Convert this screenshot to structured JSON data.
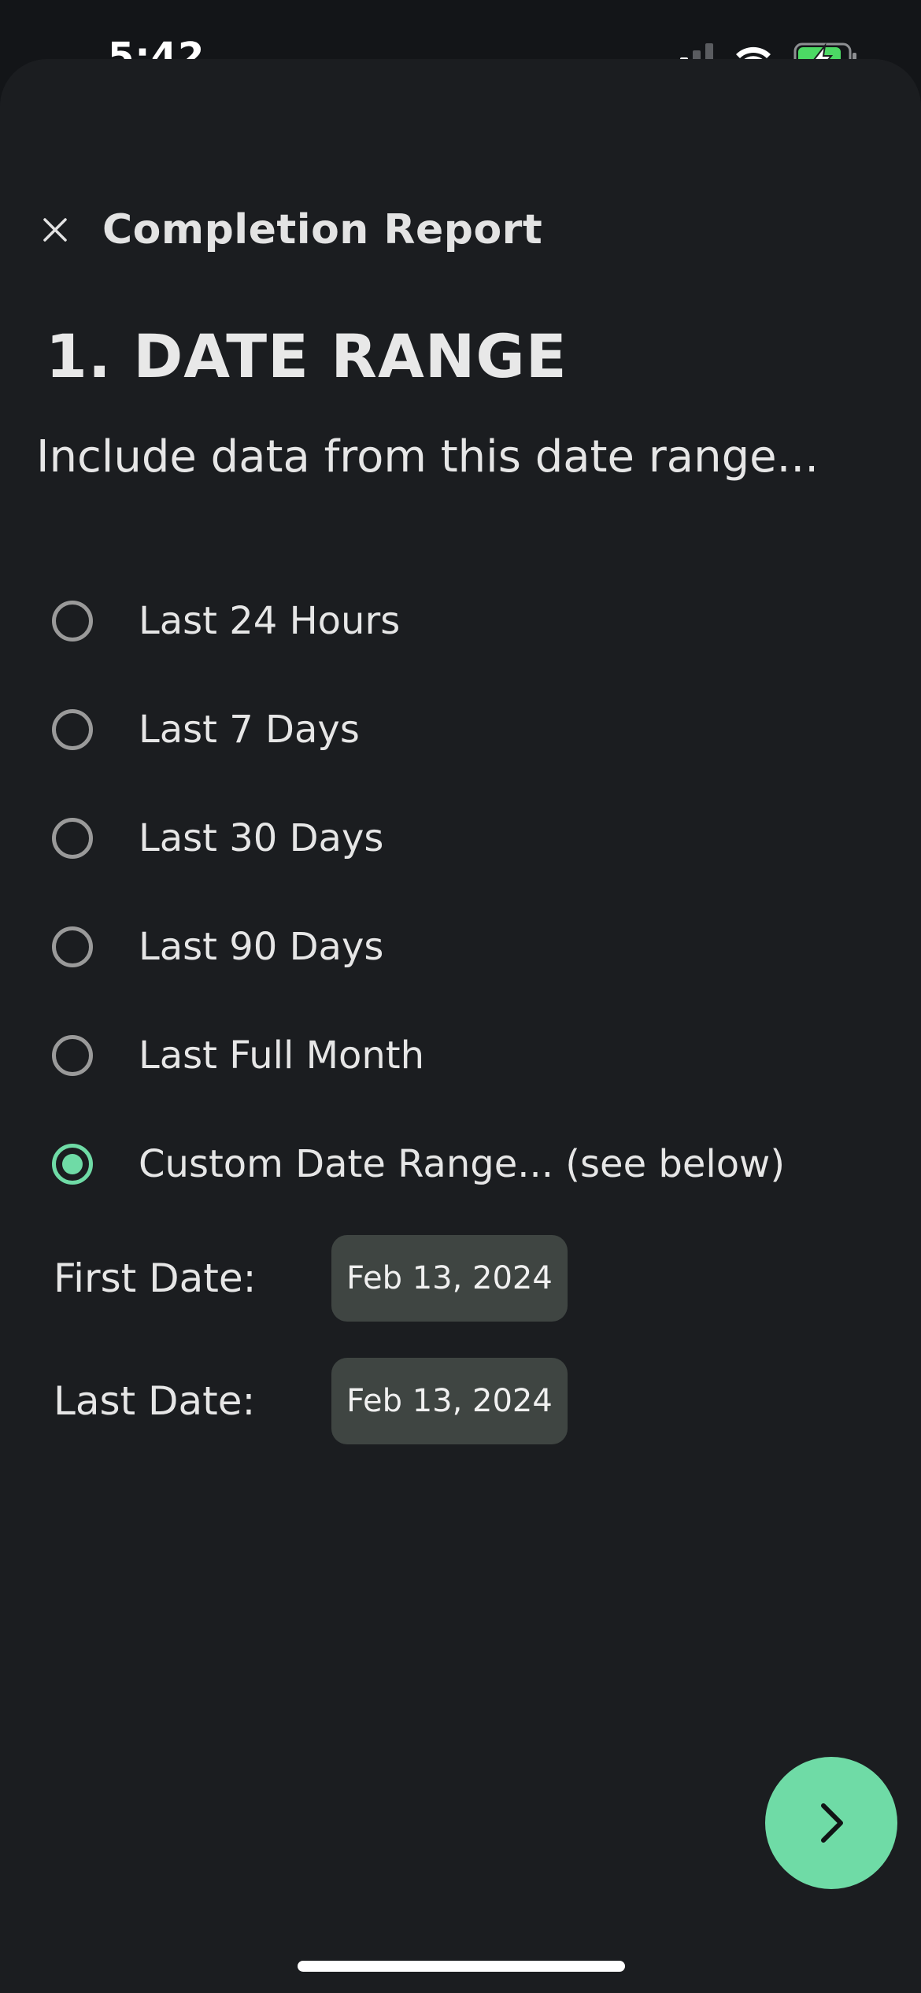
{
  "status_bar": {
    "time": "5:42"
  },
  "header": {
    "title": "Completion Report"
  },
  "section": {
    "title": "1. DATE RANGE",
    "description": "Include data from this date range..."
  },
  "options": [
    {
      "label": "Last 24 Hours",
      "selected": false
    },
    {
      "label": "Last 7 Days",
      "selected": false
    },
    {
      "label": "Last 30 Days",
      "selected": false
    },
    {
      "label": "Last 90 Days",
      "selected": false
    },
    {
      "label": "Last Full Month",
      "selected": false
    },
    {
      "label": "Custom Date Range... (see below)",
      "selected": true
    }
  ],
  "custom_range": {
    "first_label": "First Date:",
    "first_value": "Feb 13, 2024",
    "last_label": "Last Date:",
    "last_value": "Feb 13, 2024"
  },
  "colors": {
    "accent": "#6fdba6",
    "background": "#1b1d20",
    "chip": "#3f4542"
  },
  "icons": {
    "close": "close-icon",
    "next": "chevron-right-icon"
  }
}
